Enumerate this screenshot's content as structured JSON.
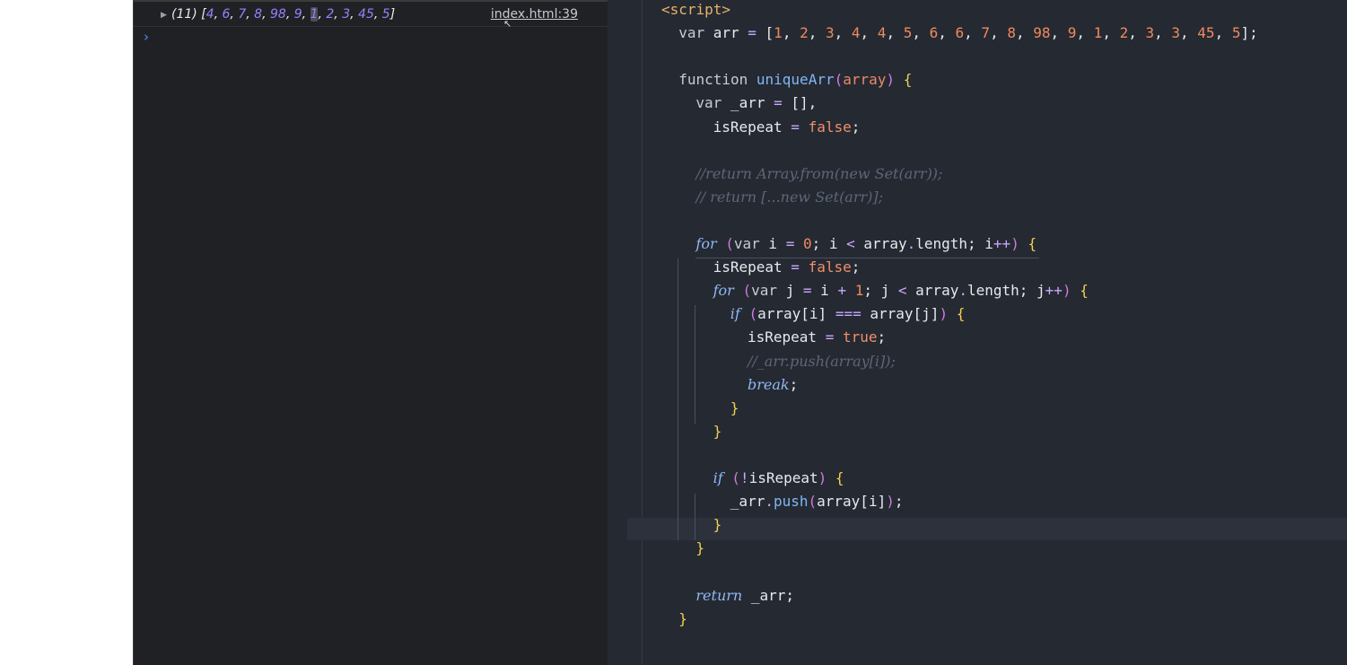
{
  "console": {
    "log": {
      "count": "(11)",
      "values": [
        "4",
        "6",
        "7",
        "8",
        "98",
        "9",
        "1",
        "2",
        "3",
        "45",
        "5"
      ],
      "highlighted_index": 6,
      "source": "index.html:39"
    },
    "prompt": "›"
  },
  "editor": {
    "lines": [
      {
        "indent": 0,
        "text": "<script>"
      },
      {
        "indent": 1,
        "text": "var arr = [1, 2, 3, 4, 4, 5, 6, 6, 7, 8, 98, 9, 1, 2, 3, 3, 45, 5];"
      },
      {
        "indent": 0,
        "text": ""
      },
      {
        "indent": 1,
        "text": "function uniqueArr(array) {"
      },
      {
        "indent": 2,
        "text": "var _arr = [],"
      },
      {
        "indent": 3,
        "text": "isRepeat = false;"
      },
      {
        "indent": 0,
        "text": ""
      },
      {
        "indent": 2,
        "text": "//return Array.from(new Set(arr));"
      },
      {
        "indent": 2,
        "text": "// return [...new Set(arr)];"
      },
      {
        "indent": 0,
        "text": ""
      },
      {
        "indent": 2,
        "text": "for (var i = 0; i < array.length; i++) {"
      },
      {
        "indent": 3,
        "text": "isRepeat = false;"
      },
      {
        "indent": 3,
        "text": "for (var j = i + 1; j < array.length; j++) {"
      },
      {
        "indent": 4,
        "text": "if (array[i] === array[j]) {"
      },
      {
        "indent": 5,
        "text": "isRepeat = true;"
      },
      {
        "indent": 5,
        "text": "//_arr.push(array[i]);"
      },
      {
        "indent": 5,
        "text": "break;"
      },
      {
        "indent": 4,
        "text": "}"
      },
      {
        "indent": 3,
        "text": "}"
      },
      {
        "indent": 0,
        "text": ""
      },
      {
        "indent": 3,
        "text": "if (!isRepeat) {"
      },
      {
        "indent": 4,
        "text": "_arr.push(array[i]);"
      },
      {
        "indent": 3,
        "text": "}"
      },
      {
        "indent": 2,
        "text": "}"
      },
      {
        "indent": 0,
        "text": ""
      },
      {
        "indent": 2,
        "text": "return _arr;"
      },
      {
        "indent": 1,
        "text": "}"
      }
    ]
  },
  "colors": {
    "console_bg": "#202124",
    "editor_bg": "#252932",
    "number": "#9980ff",
    "link": "#4f8ff7"
  }
}
